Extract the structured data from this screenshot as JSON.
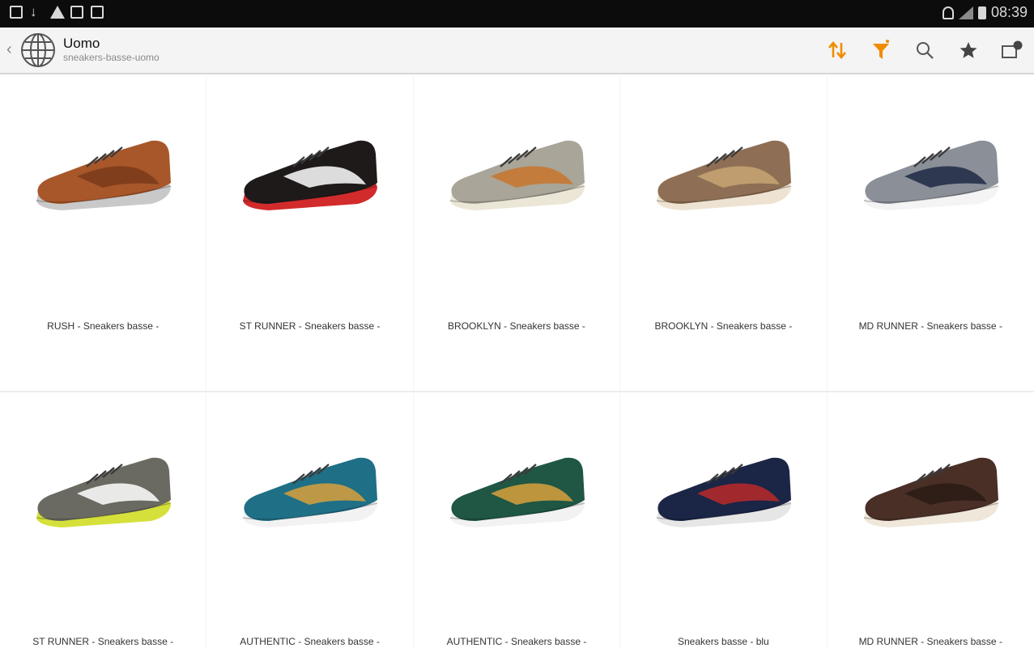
{
  "status_bar": {
    "time": "08:39",
    "left_icons": [
      "gallery-icon",
      "download-icon",
      "warning-icon",
      "clipboard-icon",
      "bag-icon"
    ],
    "right_icons": [
      "wifi-icon",
      "signal-icon",
      "battery-icon"
    ]
  },
  "action_bar": {
    "title": "Uomo",
    "subtitle": "sneakers-basse-uomo",
    "icons": [
      "back-chevron-icon",
      "globe-icon",
      "sort-icon",
      "filter-icon",
      "search-icon",
      "favorites-star-icon",
      "cart-icon"
    ],
    "accent_color": "#f08c00",
    "cart_badge": ""
  },
  "products": [
    {
      "title": "RUSH - Sneakers basse -",
      "colors": {
        "upper": "#a8572a",
        "sole": "#c9c9c9",
        "accent": "#7a3a1a"
      }
    },
    {
      "title": "ST RUNNER - Sneakers basse -",
      "colors": {
        "upper": "#1e1a1a",
        "sole": "#d22b2b",
        "accent": "#ffffff"
      }
    },
    {
      "title": "BROOKLYN - Sneakers basse -",
      "colors": {
        "upper": "#a9a598",
        "sole": "#ece6d7",
        "accent": "#c8742c"
      }
    },
    {
      "title": "BROOKLYN - Sneakers basse -",
      "colors": {
        "upper": "#8e6f55",
        "sole": "#eee3d2",
        "accent": "#c9a673"
      }
    },
    {
      "title": "MD RUNNER - Sneakers basse -",
      "colors": {
        "upper": "#8a8f98",
        "sole": "#f4f4f4",
        "accent": "#1d2a44"
      }
    },
    {
      "title": "ST RUNNER - Sneakers basse -",
      "colors": {
        "upper": "#6b6a62",
        "sole": "#d5e13a",
        "accent": "#ffffff"
      }
    },
    {
      "title": "AUTHENTIC - Sneakers basse -",
      "colors": {
        "upper": "#1f6f86",
        "sole": "#f2f2f2",
        "accent": "#d8a03c"
      }
    },
    {
      "title": "AUTHENTIC - Sneakers basse -",
      "colors": {
        "upper": "#1f5644",
        "sole": "#f2f2f2",
        "accent": "#d8a03c"
      }
    },
    {
      "title": "Sneakers basse - blu",
      "colors": {
        "upper": "#1b2546",
        "sole": "#e6e6e6",
        "accent": "#b82a2a"
      }
    },
    {
      "title": "MD RUNNER - Sneakers basse -",
      "colors": {
        "upper": "#4a2f27",
        "sole": "#efe7da",
        "accent": "#2a1a15"
      }
    }
  ]
}
